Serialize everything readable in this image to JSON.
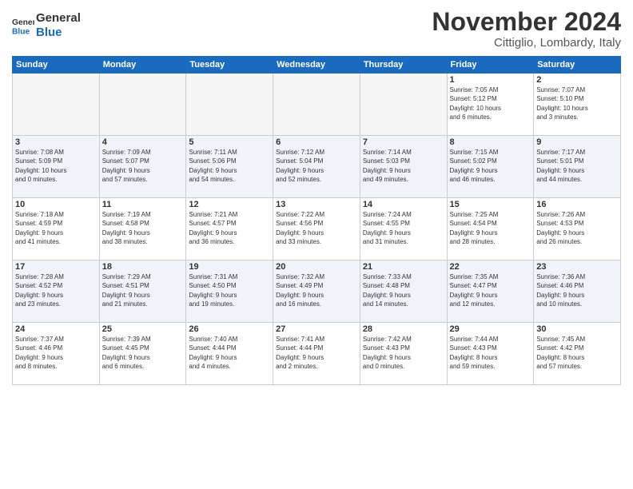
{
  "header": {
    "logo_line1": "General",
    "logo_line2": "Blue",
    "month": "November 2024",
    "location": "Cittiglio, Lombardy, Italy"
  },
  "days_of_week": [
    "Sunday",
    "Monday",
    "Tuesday",
    "Wednesday",
    "Thursday",
    "Friday",
    "Saturday"
  ],
  "weeks": [
    [
      {
        "day": "",
        "info": "",
        "empty": true
      },
      {
        "day": "",
        "info": "",
        "empty": true
      },
      {
        "day": "",
        "info": "",
        "empty": true
      },
      {
        "day": "",
        "info": "",
        "empty": true
      },
      {
        "day": "",
        "info": "",
        "empty": true
      },
      {
        "day": "1",
        "info": "Sunrise: 7:05 AM\nSunset: 5:12 PM\nDaylight: 10 hours\nand 6 minutes.",
        "empty": false
      },
      {
        "day": "2",
        "info": "Sunrise: 7:07 AM\nSunset: 5:10 PM\nDaylight: 10 hours\nand 3 minutes.",
        "empty": false
      }
    ],
    [
      {
        "day": "3",
        "info": "Sunrise: 7:08 AM\nSunset: 5:09 PM\nDaylight: 10 hours\nand 0 minutes.",
        "empty": false
      },
      {
        "day": "4",
        "info": "Sunrise: 7:09 AM\nSunset: 5:07 PM\nDaylight: 9 hours\nand 57 minutes.",
        "empty": false
      },
      {
        "day": "5",
        "info": "Sunrise: 7:11 AM\nSunset: 5:06 PM\nDaylight: 9 hours\nand 54 minutes.",
        "empty": false
      },
      {
        "day": "6",
        "info": "Sunrise: 7:12 AM\nSunset: 5:04 PM\nDaylight: 9 hours\nand 52 minutes.",
        "empty": false
      },
      {
        "day": "7",
        "info": "Sunrise: 7:14 AM\nSunset: 5:03 PM\nDaylight: 9 hours\nand 49 minutes.",
        "empty": false
      },
      {
        "day": "8",
        "info": "Sunrise: 7:15 AM\nSunset: 5:02 PM\nDaylight: 9 hours\nand 46 minutes.",
        "empty": false
      },
      {
        "day": "9",
        "info": "Sunrise: 7:17 AM\nSunset: 5:01 PM\nDaylight: 9 hours\nand 44 minutes.",
        "empty": false
      }
    ],
    [
      {
        "day": "10",
        "info": "Sunrise: 7:18 AM\nSunset: 4:59 PM\nDaylight: 9 hours\nand 41 minutes.",
        "empty": false
      },
      {
        "day": "11",
        "info": "Sunrise: 7:19 AM\nSunset: 4:58 PM\nDaylight: 9 hours\nand 38 minutes.",
        "empty": false
      },
      {
        "day": "12",
        "info": "Sunrise: 7:21 AM\nSunset: 4:57 PM\nDaylight: 9 hours\nand 36 minutes.",
        "empty": false
      },
      {
        "day": "13",
        "info": "Sunrise: 7:22 AM\nSunset: 4:56 PM\nDaylight: 9 hours\nand 33 minutes.",
        "empty": false
      },
      {
        "day": "14",
        "info": "Sunrise: 7:24 AM\nSunset: 4:55 PM\nDaylight: 9 hours\nand 31 minutes.",
        "empty": false
      },
      {
        "day": "15",
        "info": "Sunrise: 7:25 AM\nSunset: 4:54 PM\nDaylight: 9 hours\nand 28 minutes.",
        "empty": false
      },
      {
        "day": "16",
        "info": "Sunrise: 7:26 AM\nSunset: 4:53 PM\nDaylight: 9 hours\nand 26 minutes.",
        "empty": false
      }
    ],
    [
      {
        "day": "17",
        "info": "Sunrise: 7:28 AM\nSunset: 4:52 PM\nDaylight: 9 hours\nand 23 minutes.",
        "empty": false
      },
      {
        "day": "18",
        "info": "Sunrise: 7:29 AM\nSunset: 4:51 PM\nDaylight: 9 hours\nand 21 minutes.",
        "empty": false
      },
      {
        "day": "19",
        "info": "Sunrise: 7:31 AM\nSunset: 4:50 PM\nDaylight: 9 hours\nand 19 minutes.",
        "empty": false
      },
      {
        "day": "20",
        "info": "Sunrise: 7:32 AM\nSunset: 4:49 PM\nDaylight: 9 hours\nand 16 minutes.",
        "empty": false
      },
      {
        "day": "21",
        "info": "Sunrise: 7:33 AM\nSunset: 4:48 PM\nDaylight: 9 hours\nand 14 minutes.",
        "empty": false
      },
      {
        "day": "22",
        "info": "Sunrise: 7:35 AM\nSunset: 4:47 PM\nDaylight: 9 hours\nand 12 minutes.",
        "empty": false
      },
      {
        "day": "23",
        "info": "Sunrise: 7:36 AM\nSunset: 4:46 PM\nDaylight: 9 hours\nand 10 minutes.",
        "empty": false
      }
    ],
    [
      {
        "day": "24",
        "info": "Sunrise: 7:37 AM\nSunset: 4:46 PM\nDaylight: 9 hours\nand 8 minutes.",
        "empty": false
      },
      {
        "day": "25",
        "info": "Sunrise: 7:39 AM\nSunset: 4:45 PM\nDaylight: 9 hours\nand 6 minutes.",
        "empty": false
      },
      {
        "day": "26",
        "info": "Sunrise: 7:40 AM\nSunset: 4:44 PM\nDaylight: 9 hours\nand 4 minutes.",
        "empty": false
      },
      {
        "day": "27",
        "info": "Sunrise: 7:41 AM\nSunset: 4:44 PM\nDaylight: 9 hours\nand 2 minutes.",
        "empty": false
      },
      {
        "day": "28",
        "info": "Sunrise: 7:42 AM\nSunset: 4:43 PM\nDaylight: 9 hours\nand 0 minutes.",
        "empty": false
      },
      {
        "day": "29",
        "info": "Sunrise: 7:44 AM\nSunset: 4:43 PM\nDaylight: 8 hours\nand 59 minutes.",
        "empty": false
      },
      {
        "day": "30",
        "info": "Sunrise: 7:45 AM\nSunset: 4:42 PM\nDaylight: 8 hours\nand 57 minutes.",
        "empty": false
      }
    ]
  ]
}
